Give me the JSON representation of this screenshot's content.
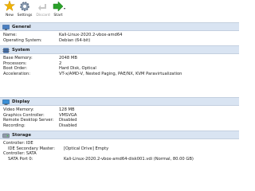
{
  "toolbar": {
    "new": "New",
    "settings": "Settings",
    "discard": "Discard",
    "start": "Start"
  },
  "colors": {
    "header_bg": "#d9e4f2",
    "new_icon": "#f0b400",
    "start_arrow": "#2aa12a"
  },
  "icons": {
    "new": "starburst-icon",
    "settings": "gear-icon",
    "discard": "discard-arrow-icon",
    "start": "green-arrow-icon",
    "general": "monitor-icon",
    "system": "chip-icon",
    "display": "display-icon",
    "storage": "disk-icon"
  },
  "general": {
    "title": "General",
    "name_k": "Name:",
    "name_v": "Kali-Linux-2020.2-vbox-amd64",
    "os_k": "Operating System:",
    "os_v": "Debian (64-bit)"
  },
  "system": {
    "title": "System",
    "mem_k": "Base Memory:",
    "mem_v": "2048 MB",
    "proc_k": "Processors:",
    "proc_v": "2",
    "boot_k": "Boot Order:",
    "boot_v": "Hard Disk, Optical",
    "accel_k": "Acceleration:",
    "accel_v": "VT-x/AMD-V, Nested Paging, PAE/NX, KVM Paravirtualization"
  },
  "display": {
    "title": "Display",
    "vmem_k": "Video Memory:",
    "vmem_v": "128 MB",
    "gc_k": "Graphics Controller:",
    "gc_v": "VMSVGA",
    "rds_k": "Remote Desktop Server:",
    "rds_v": "Disabled",
    "rec_k": "Recording:",
    "rec_v": "Disabled"
  },
  "storage": {
    "title": "Storage",
    "ctrl_ide": "Controller: IDE",
    "ide_k": "IDE Secondary Master:",
    "ide_v": "[Optical Drive] Empty",
    "ctrl_sata": "Controller: SATA",
    "sata_k": "SATA Port 0:",
    "sata_v": "Kali-Linux-2020.2-vbox-amd64-disk001.vdi (Normal, 80.00 GB)"
  }
}
